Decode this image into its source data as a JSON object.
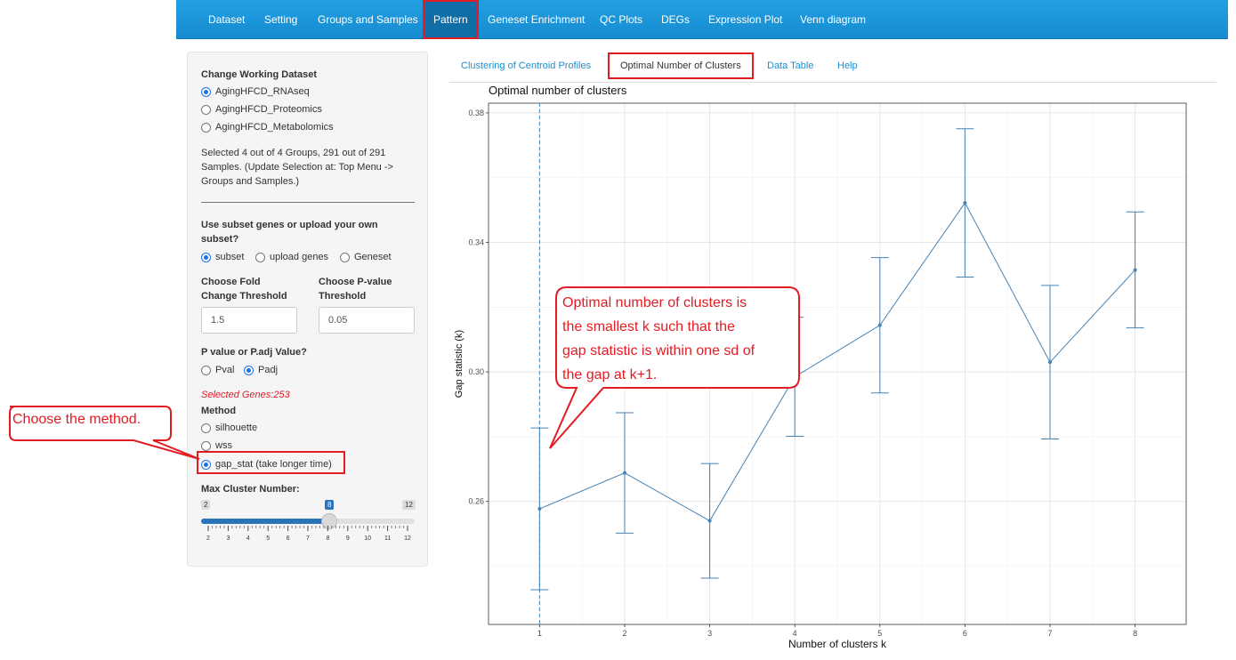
{
  "nav": {
    "items": [
      "Dataset",
      "Setting",
      "Groups and Samples",
      "Pattern",
      "Geneset Enrichment",
      "QC Plots",
      "DEGs",
      "Expression Plot",
      "Venn diagram"
    ],
    "active": "Pattern"
  },
  "sidebar": {
    "dataset_heading": "Change Working Dataset",
    "datasets": [
      "AgingHFCD_RNAseq",
      "AgingHFCD_Proteomics",
      "AgingHFCD_Metabolomics"
    ],
    "selected_dataset": "AgingHFCD_RNAseq",
    "selection_info_lines": [
      "Selected 4 out of 4 Groups, 291 out of 291",
      "Samples. (Update Selection at: Top Menu ->",
      "Groups and Samples.)"
    ],
    "subset_heading_lines": [
      "Use subset genes or upload your own",
      "subset?"
    ],
    "subset_options": [
      "subset",
      "upload genes",
      "Geneset"
    ],
    "selected_subset": "subset",
    "fold_label_lines": [
      "Choose Fold",
      "Change Threshold"
    ],
    "fold_value": "1.5",
    "pvalue_label_lines": [
      "Choose P-value",
      "Threshold"
    ],
    "pvalue_value": "0.05",
    "pval_heading": "P value or P.adj Value?",
    "pval_options": [
      "Pval",
      "Padj"
    ],
    "selected_pval": "Padj",
    "selected_genes": "Selected Genes:253",
    "method_heading": "Method",
    "methods": [
      "silhouette",
      "wss",
      "gap_stat (take longer time)"
    ],
    "selected_method": "gap_stat (take longer time)",
    "max_cluster_heading": "Max Cluster Number:",
    "slider": {
      "min": 2,
      "max": 12,
      "value": 8,
      "min_label": "2",
      "max_label": "12",
      "value_label": "8",
      "ticks": [
        "2",
        "3",
        "4",
        "5",
        "6",
        "7",
        "8",
        "9",
        "10",
        "11",
        "12"
      ]
    }
  },
  "tabs": {
    "items": [
      "Clustering of Centroid Profiles",
      "Optimal Number of Clusters",
      "Data Table",
      "Help"
    ],
    "active": "Optimal Number of Clusters"
  },
  "annotations": {
    "method_callout": "Choose the method.",
    "chart_callout_lines": [
      "Optimal number of clusters is",
      "the smallest k such that the",
      "gap statistic is within one sd of",
      "the gap at k+1."
    ]
  },
  "colors": {
    "accent": "#1b93d8",
    "annotation_red": "#e31b23",
    "series": "#4682b4"
  },
  "chart_data": {
    "type": "line",
    "title": "Optimal number of clusters",
    "xlabel": "Number of clusters k",
    "ylabel": "Gap statistic (k)",
    "x": [
      1,
      2,
      3,
      4,
      5,
      6,
      7,
      8
    ],
    "x_tick_labels": [
      "1",
      "2",
      "3",
      "4",
      "5",
      "6",
      "7",
      "8"
    ],
    "y_tick_labels": [
      "0.26",
      "0.30",
      "0.34",
      "0.38"
    ],
    "y_ticks": [
      0.26,
      0.3,
      0.34,
      0.38
    ],
    "ylim": [
      0.222,
      0.383
    ],
    "xlim": [
      0.4,
      8.6
    ],
    "series": [
      {
        "values": [
          0.2577,
          0.2688,
          0.254,
          0.2985,
          0.3144,
          0.3522,
          0.303,
          0.3315
        ],
        "lower": [
          0.2327,
          0.2502,
          0.2363,
          0.2801,
          0.2935,
          0.3293,
          0.2793,
          0.3136
        ],
        "upper": [
          0.2827,
          0.2874,
          0.2717,
          0.3169,
          0.3353,
          0.3751,
          0.3267,
          0.3494
        ]
      }
    ],
    "optimal_k": 1,
    "grid": true
  }
}
